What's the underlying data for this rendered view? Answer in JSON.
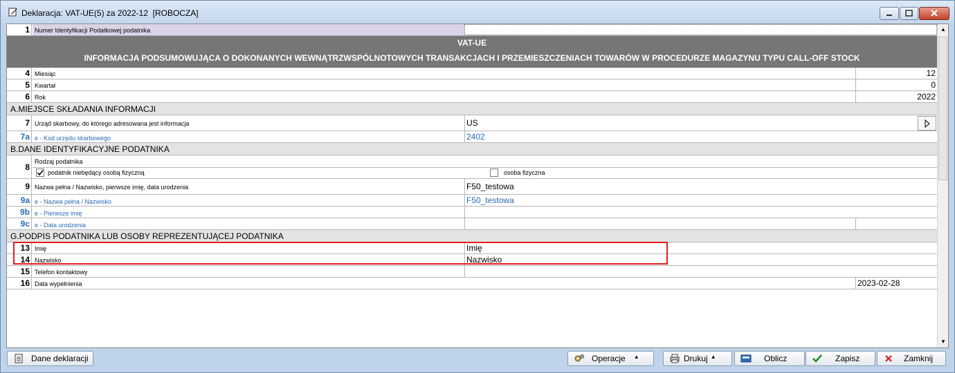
{
  "window": {
    "title": "Deklaracja: VAT-UE(5) za 2022-12  [ROBOCZA]"
  },
  "form": {
    "row1": {
      "num": "1",
      "label": "Numer Identyfikacji Podatkowej podatnika",
      "value": ""
    },
    "banner": {
      "line1": "VAT-UE",
      "line2": "INFORMACJA PODSUMOWUJĄCA O DOKONANYCH WEWNĄTRZWSPÓLNOTOWYCH TRANSAKCJACH I PRZEMIESZCZENIACH TOWARÓW W PROCEDURZE MAGAZYNU TYPU CALL-OFF STOCK"
    },
    "row4": {
      "num": "4",
      "label": "Miesiąc",
      "value": "12"
    },
    "row5": {
      "num": "5",
      "label": "Kwartał",
      "value": "0"
    },
    "row6": {
      "num": "6",
      "label": "Rok",
      "value": "2022"
    },
    "sectionA": "A.MIEJSCE SKŁADANIA INFORMACJI",
    "row7": {
      "num": "7",
      "label": "Urząd skarbowy, do którego adresowana jest informacja",
      "value": "US",
      "lookup_icon": "arrow-right"
    },
    "row7a": {
      "num": "7a",
      "label": "e - Kod urzędu skarbowego",
      "value": "2402"
    },
    "sectionB": "B.DANE IDENTYFIKACYJNE PODATNIKA",
    "row8": {
      "num": "8",
      "label": "Rodzaj podatnika",
      "option1": {
        "label": "podatnik niebędący osobą fizyczną",
        "checked": true
      },
      "option2": {
        "label": "osoba fizyczna",
        "checked": false
      }
    },
    "row9": {
      "num": "9",
      "label": "Nazwa pełna / Nazwisko, pierwsze imię, data urodzenia",
      "value": "F50_testowa"
    },
    "row9a": {
      "num": "9a",
      "label": "e - Nazwa pełna / Nazwisko",
      "value": "F50_testowa"
    },
    "row9b": {
      "num": "9b",
      "label": "e - Pierwsze imię",
      "value": ""
    },
    "row9c": {
      "num": "9c",
      "label": "e - Data urodzenia",
      "value": ""
    },
    "sectionG": "G.PODPIS PODATNIKA LUB OSOBY REPREZENTUJĄCEJ PODATNIKA",
    "row13": {
      "num": "13",
      "label": "Imię",
      "value": "Imię"
    },
    "row14": {
      "num": "14",
      "label": "Nazwisko",
      "value": "Nazwisko"
    },
    "row15": {
      "num": "15",
      "label": "Telefon kontaktowy",
      "value": ""
    },
    "row16": {
      "num": "16",
      "label": "Data wypełnienia",
      "value": "2023-02-28"
    }
  },
  "footer": {
    "dane": "Dane deklaracji",
    "operacje": "Operacje",
    "drukuj": "Drukuj",
    "oblicz": "Oblicz",
    "zapisz": "Zapisz",
    "zamknij": "Zamknij"
  },
  "colors": {
    "highlight_border": "#e01f1f",
    "banner_bg": "#767676",
    "link_blue": "#2a6bb5",
    "row1_label_bg": "#dcd3e8"
  }
}
